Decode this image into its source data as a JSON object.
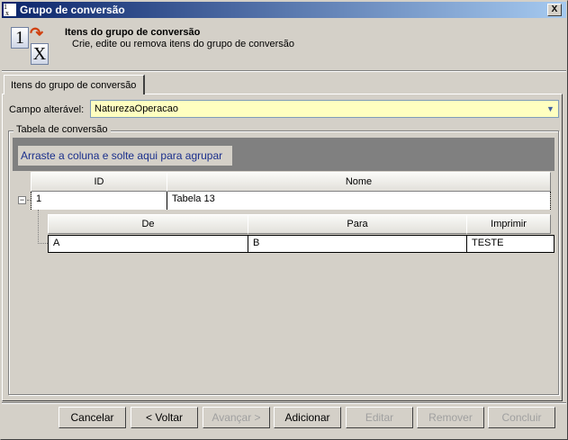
{
  "window": {
    "title": "Grupo de conversão",
    "close": "X"
  },
  "header": {
    "icon_from": "1",
    "icon_to": "X",
    "title": "Itens do grupo de conversão",
    "subtitle": "Crie, edite ou remova itens do grupo de conversão"
  },
  "tabs": [
    {
      "label": "Itens do grupo de conversão",
      "active": true
    }
  ],
  "field": {
    "label": "Campo alterável:",
    "value": "NaturezaOperacao",
    "arrow": "▼"
  },
  "group": {
    "title": "Tabela de conversão",
    "drag_hint": "Arraste a coluna e solte aqui para agrupar"
  },
  "grid": {
    "columns": [
      "ID",
      "Nome"
    ],
    "rows": [
      {
        "id": "1",
        "nome": "Tabela 13",
        "expanded": true,
        "expander": "−"
      }
    ],
    "child": {
      "columns": [
        "De",
        "Para",
        "Imprimir"
      ],
      "rows": [
        [
          "A",
          "B",
          "TESTE"
        ]
      ]
    }
  },
  "buttons": [
    {
      "label": "Cancelar",
      "enabled": true
    },
    {
      "label": "< Voltar",
      "enabled": true
    },
    {
      "label": "Avançar >",
      "enabled": false
    },
    {
      "label": "Adicionar",
      "enabled": true
    },
    {
      "label": "Editar",
      "enabled": false
    },
    {
      "label": "Remover",
      "enabled": false
    },
    {
      "label": "Concluir",
      "enabled": false
    }
  ]
}
